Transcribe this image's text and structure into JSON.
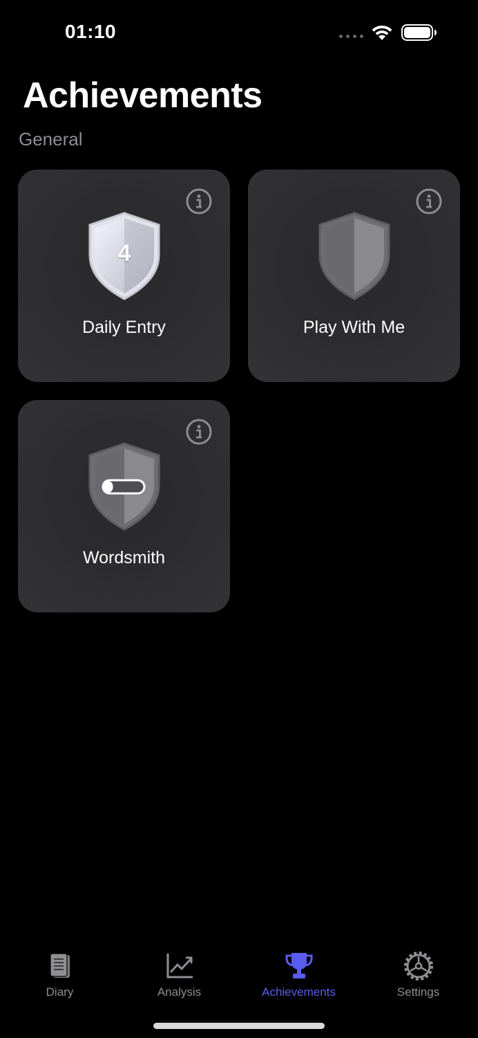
{
  "status_bar": {
    "time": "01:10"
  },
  "header": {
    "title": "Achievements"
  },
  "sections": [
    {
      "title": "General",
      "cards": [
        {
          "label": "Daily Entry",
          "badge_number": "4",
          "badge_state": "unlocked"
        },
        {
          "label": "Play With Me",
          "badge_number": "",
          "badge_state": "locked"
        },
        {
          "label": "Wordsmith",
          "badge_number": "",
          "badge_state": "locked-pill"
        }
      ]
    }
  ],
  "tab_bar": {
    "active": "Achievements",
    "active_color": "#5a5cf0",
    "tabs": [
      {
        "label": "Diary",
        "icon": "book-icon"
      },
      {
        "label": "Analysis",
        "icon": "chart-icon"
      },
      {
        "label": "Achievements",
        "icon": "trophy-icon"
      },
      {
        "label": "Settings",
        "icon": "gear-icon"
      }
    ]
  }
}
